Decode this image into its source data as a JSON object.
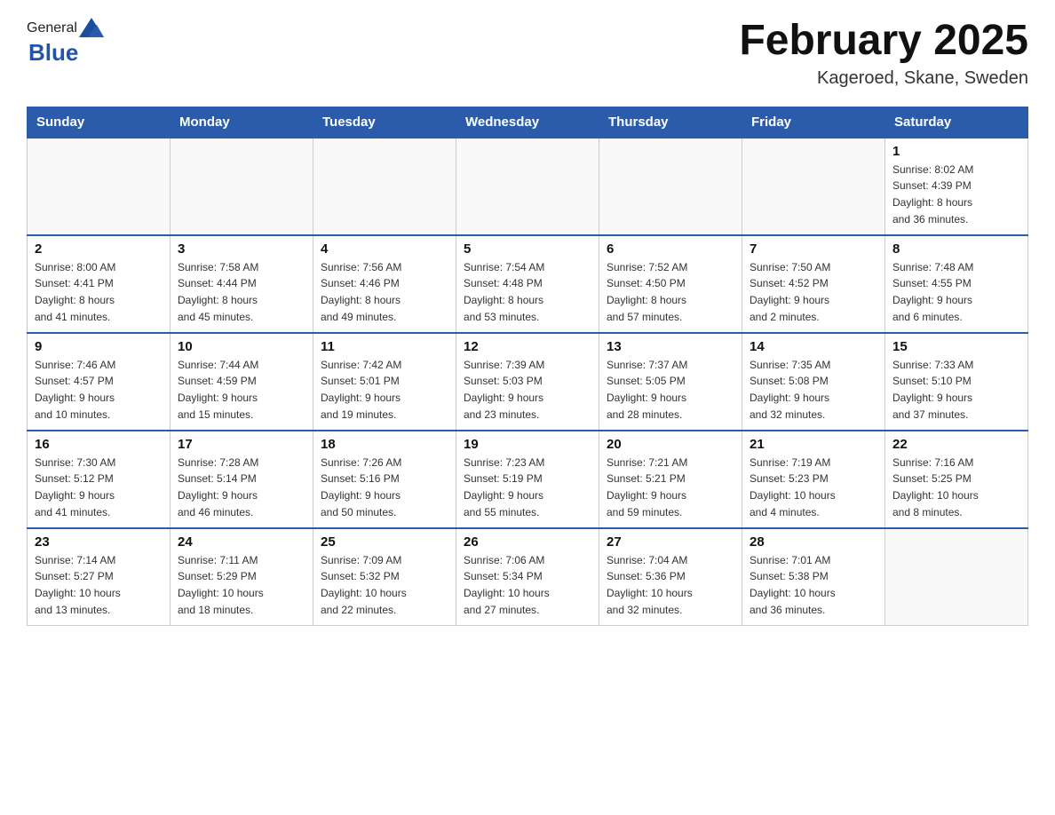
{
  "header": {
    "logo_general": "General",
    "logo_blue": "Blue",
    "title": "February 2025",
    "subtitle": "Kageroed, Skane, Sweden"
  },
  "weekdays": [
    "Sunday",
    "Monday",
    "Tuesday",
    "Wednesday",
    "Thursday",
    "Friday",
    "Saturday"
  ],
  "weeks": [
    [
      {
        "day": "",
        "info": ""
      },
      {
        "day": "",
        "info": ""
      },
      {
        "day": "",
        "info": ""
      },
      {
        "day": "",
        "info": ""
      },
      {
        "day": "",
        "info": ""
      },
      {
        "day": "",
        "info": ""
      },
      {
        "day": "1",
        "info": "Sunrise: 8:02 AM\nSunset: 4:39 PM\nDaylight: 8 hours\nand 36 minutes."
      }
    ],
    [
      {
        "day": "2",
        "info": "Sunrise: 8:00 AM\nSunset: 4:41 PM\nDaylight: 8 hours\nand 41 minutes."
      },
      {
        "day": "3",
        "info": "Sunrise: 7:58 AM\nSunset: 4:44 PM\nDaylight: 8 hours\nand 45 minutes."
      },
      {
        "day": "4",
        "info": "Sunrise: 7:56 AM\nSunset: 4:46 PM\nDaylight: 8 hours\nand 49 minutes."
      },
      {
        "day": "5",
        "info": "Sunrise: 7:54 AM\nSunset: 4:48 PM\nDaylight: 8 hours\nand 53 minutes."
      },
      {
        "day": "6",
        "info": "Sunrise: 7:52 AM\nSunset: 4:50 PM\nDaylight: 8 hours\nand 57 minutes."
      },
      {
        "day": "7",
        "info": "Sunrise: 7:50 AM\nSunset: 4:52 PM\nDaylight: 9 hours\nand 2 minutes."
      },
      {
        "day": "8",
        "info": "Sunrise: 7:48 AM\nSunset: 4:55 PM\nDaylight: 9 hours\nand 6 minutes."
      }
    ],
    [
      {
        "day": "9",
        "info": "Sunrise: 7:46 AM\nSunset: 4:57 PM\nDaylight: 9 hours\nand 10 minutes."
      },
      {
        "day": "10",
        "info": "Sunrise: 7:44 AM\nSunset: 4:59 PM\nDaylight: 9 hours\nand 15 minutes."
      },
      {
        "day": "11",
        "info": "Sunrise: 7:42 AM\nSunset: 5:01 PM\nDaylight: 9 hours\nand 19 minutes."
      },
      {
        "day": "12",
        "info": "Sunrise: 7:39 AM\nSunset: 5:03 PM\nDaylight: 9 hours\nand 23 minutes."
      },
      {
        "day": "13",
        "info": "Sunrise: 7:37 AM\nSunset: 5:05 PM\nDaylight: 9 hours\nand 28 minutes."
      },
      {
        "day": "14",
        "info": "Sunrise: 7:35 AM\nSunset: 5:08 PM\nDaylight: 9 hours\nand 32 minutes."
      },
      {
        "day": "15",
        "info": "Sunrise: 7:33 AM\nSunset: 5:10 PM\nDaylight: 9 hours\nand 37 minutes."
      }
    ],
    [
      {
        "day": "16",
        "info": "Sunrise: 7:30 AM\nSunset: 5:12 PM\nDaylight: 9 hours\nand 41 minutes."
      },
      {
        "day": "17",
        "info": "Sunrise: 7:28 AM\nSunset: 5:14 PM\nDaylight: 9 hours\nand 46 minutes."
      },
      {
        "day": "18",
        "info": "Sunrise: 7:26 AM\nSunset: 5:16 PM\nDaylight: 9 hours\nand 50 minutes."
      },
      {
        "day": "19",
        "info": "Sunrise: 7:23 AM\nSunset: 5:19 PM\nDaylight: 9 hours\nand 55 minutes."
      },
      {
        "day": "20",
        "info": "Sunrise: 7:21 AM\nSunset: 5:21 PM\nDaylight: 9 hours\nand 59 minutes."
      },
      {
        "day": "21",
        "info": "Sunrise: 7:19 AM\nSunset: 5:23 PM\nDaylight: 10 hours\nand 4 minutes."
      },
      {
        "day": "22",
        "info": "Sunrise: 7:16 AM\nSunset: 5:25 PM\nDaylight: 10 hours\nand 8 minutes."
      }
    ],
    [
      {
        "day": "23",
        "info": "Sunrise: 7:14 AM\nSunset: 5:27 PM\nDaylight: 10 hours\nand 13 minutes."
      },
      {
        "day": "24",
        "info": "Sunrise: 7:11 AM\nSunset: 5:29 PM\nDaylight: 10 hours\nand 18 minutes."
      },
      {
        "day": "25",
        "info": "Sunrise: 7:09 AM\nSunset: 5:32 PM\nDaylight: 10 hours\nand 22 minutes."
      },
      {
        "day": "26",
        "info": "Sunrise: 7:06 AM\nSunset: 5:34 PM\nDaylight: 10 hours\nand 27 minutes."
      },
      {
        "day": "27",
        "info": "Sunrise: 7:04 AM\nSunset: 5:36 PM\nDaylight: 10 hours\nand 32 minutes."
      },
      {
        "day": "28",
        "info": "Sunrise: 7:01 AM\nSunset: 5:38 PM\nDaylight: 10 hours\nand 36 minutes."
      },
      {
        "day": "",
        "info": ""
      }
    ]
  ]
}
